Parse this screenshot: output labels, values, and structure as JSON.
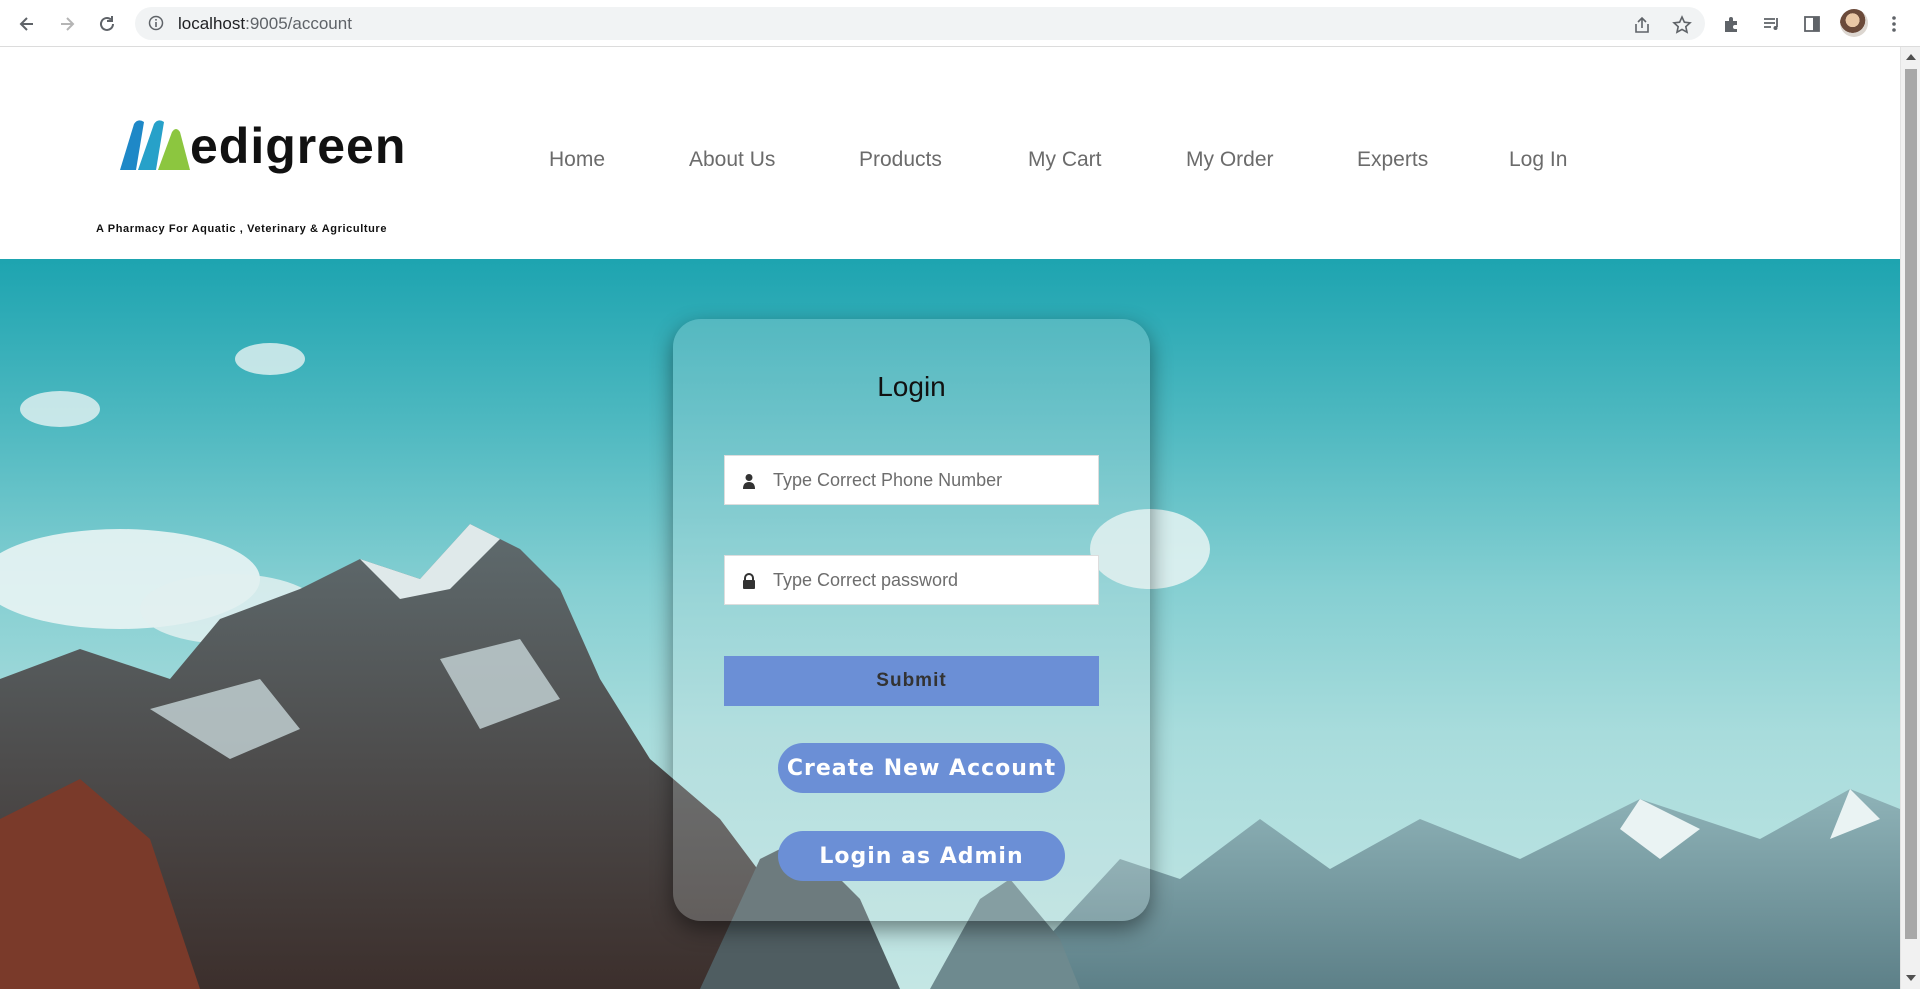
{
  "browser": {
    "url_host": "localhost",
    "url_rest": ":9005/account",
    "icons": [
      "back-arrow-icon",
      "forward-arrow-icon",
      "reload-icon",
      "info-icon",
      "share-icon",
      "star-icon",
      "puzzle-icon",
      "media-icon",
      "side-panel-icon",
      "more-vert-icon"
    ]
  },
  "header": {
    "logo_word": "edigreen",
    "logo_tagline": "A Pharmacy For Aquatic , Veterinary & Agriculture",
    "menu": [
      "Home",
      "About Us",
      "Products",
      "My Cart",
      "My Order",
      "Experts",
      "Log In"
    ]
  },
  "login": {
    "title": "Login",
    "phone_placeholder": "Type Correct Phone Number",
    "password_placeholder": "Type Correct password",
    "submit_label": "Submit",
    "create_label": "Create New Account",
    "admin_label": "Login as Admin"
  },
  "colors": {
    "accent_button": "#6b8fd6",
    "logo_blue": "#1e88c7",
    "logo_green": "#8cc63f"
  }
}
